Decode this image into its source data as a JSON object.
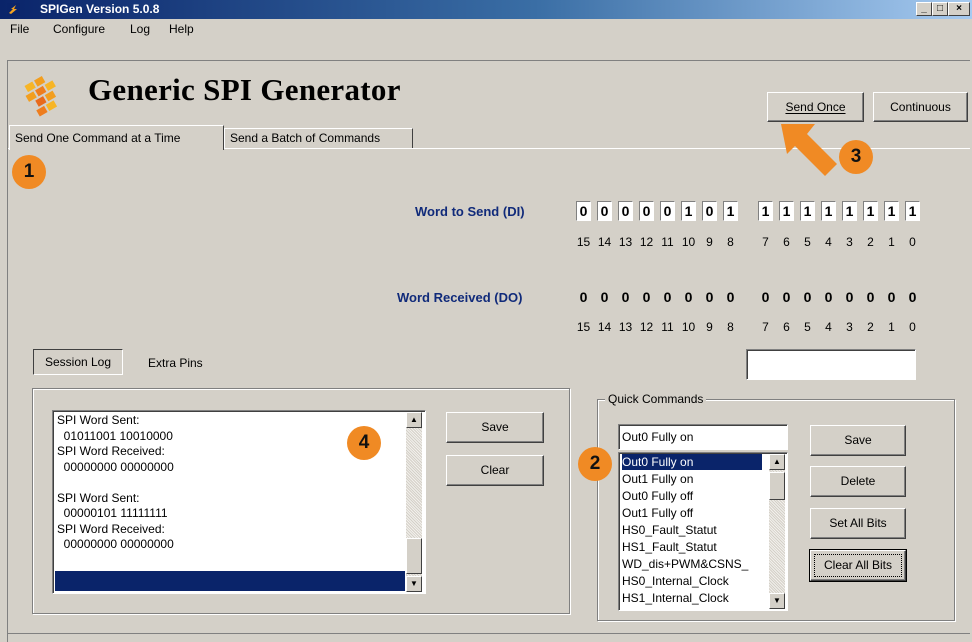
{
  "window": {
    "title": "SPIGen Version 5.0.8",
    "controls": [
      "_",
      "□",
      "×"
    ]
  },
  "menu": [
    "File",
    "Configure",
    "Log",
    "Help"
  ],
  "header": {
    "app_title": "Generic SPI Generator",
    "send_once_label": "Send Once",
    "continuous_label": "Continuous"
  },
  "tabs": [
    {
      "label": "Send One Command at a Time",
      "active": true
    },
    {
      "label": "Send a Batch of Commands",
      "active": false
    }
  ],
  "badges": [
    "1",
    "2",
    "3",
    "4"
  ],
  "word_send": {
    "label": "Word to Send (DI)",
    "high_bits": [
      "0",
      "0",
      "0",
      "0",
      "0",
      "1",
      "0",
      "1"
    ],
    "low_bits": [
      "1",
      "1",
      "1",
      "1",
      "1",
      "1",
      "1",
      "1"
    ]
  },
  "word_received": {
    "label": "Word Received (DO)",
    "high_bits": [
      "0",
      "0",
      "0",
      "0",
      "0",
      "0",
      "0",
      "0"
    ],
    "low_bits": [
      "0",
      "0",
      "0",
      "0",
      "0",
      "0",
      "0",
      "0"
    ]
  },
  "bit_index_high": [
    "15",
    "14",
    "13",
    "12",
    "11",
    "10",
    "9",
    "8"
  ],
  "bit_index_low": [
    "7",
    "6",
    "5",
    "4",
    "3",
    "2",
    "1",
    "0"
  ],
  "extra_field_value": "",
  "session": {
    "session_log_tab": "Session Log",
    "extra_pins_tab": "Extra Pins",
    "log_lines": [
      "SPI Word Sent:",
      "  01011001 10010000",
      "SPI Word Received:",
      "  00000000 00000000",
      "",
      "SPI Word Sent:",
      "  00000101 11111111",
      "SPI Word Received:",
      "  00000000 00000000"
    ],
    "save_label": "Save",
    "clear_label": "Clear"
  },
  "quick_commands": {
    "group_label": "Quick Commands",
    "current_value": "Out0 Fully on",
    "items": [
      "Out0 Fully on",
      "Out1 Fully on",
      "Out0 Fully off",
      "Out1 Fully off",
      "HS0_Fault_Statut",
      "HS1_Fault_Statut",
      "WD_dis+PWM&CSNS_",
      "HS0_Internal_Clock",
      "HS1_Internal_Clock"
    ],
    "selected_index": 0,
    "save_label": "Save",
    "delete_label": "Delete",
    "set_all_bits_label": "Set All Bits",
    "clear_all_bits_label": "Clear All Bits"
  },
  "colors": {
    "accent": "#0a246a",
    "badge": "#f08a24",
    "word_label": "#102a7a"
  }
}
